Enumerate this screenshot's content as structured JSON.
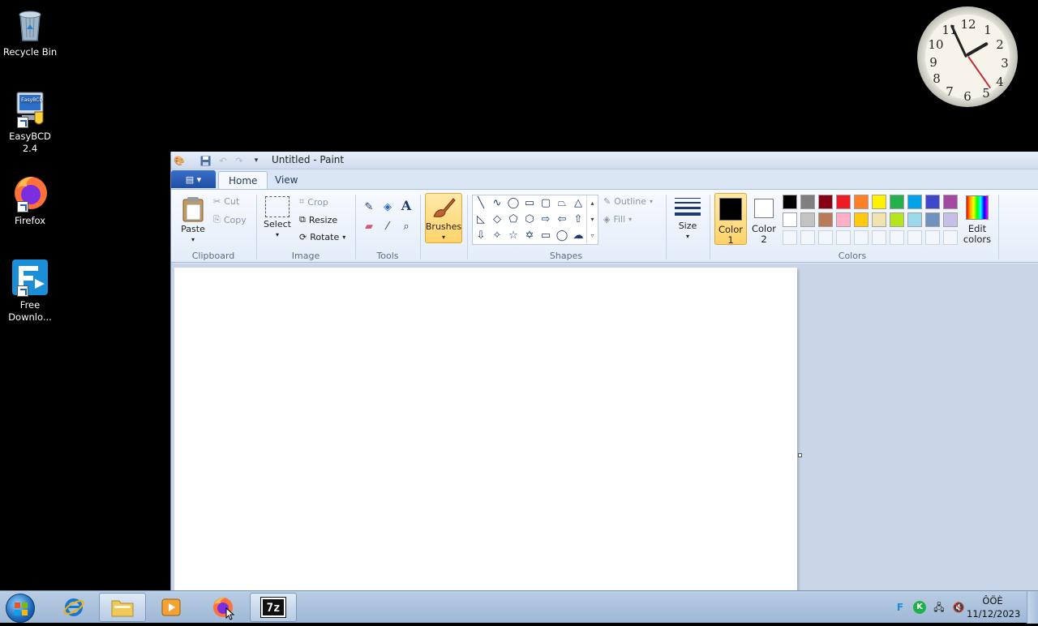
{
  "desktop": {
    "icons": [
      {
        "label": "Recycle Bin"
      },
      {
        "label": "EasyBCD 2.4"
      },
      {
        "label": "Firefox"
      },
      {
        "label": "Free Downlo..."
      }
    ],
    "clock_numbers": [
      "12",
      "1",
      "2",
      "3",
      "4",
      "5",
      "6",
      "7",
      "8",
      "9",
      "10",
      "11"
    ]
  },
  "paint": {
    "title": "Untitled - Paint",
    "tabs": {
      "home": "Home",
      "view": "View"
    },
    "clipboard": {
      "paste": "Paste",
      "cut": "Cut",
      "copy": "Copy",
      "label": "Clipboard"
    },
    "image": {
      "select": "Select",
      "crop": "Crop",
      "resize": "Resize",
      "rotate": "Rotate",
      "label": "Image"
    },
    "tools": {
      "label": "Tools"
    },
    "brushes": {
      "label": "Brushes"
    },
    "shapes": {
      "outline": "Outline",
      "fill": "Fill",
      "label": "Shapes"
    },
    "size": {
      "label": "Size"
    },
    "colors": {
      "color1_line1": "Color",
      "color1_line2": "1",
      "color2_line1": "Color",
      "color2_line2": "2",
      "edit_line1": "Edit",
      "edit_line2": "colors",
      "label": "Colors",
      "palette_row1": [
        "#000000",
        "#7f7f7f",
        "#880015",
        "#ed1c24",
        "#ff7f27",
        "#fff200",
        "#22b14c",
        "#00a2e8",
        "#3f48cc",
        "#a349a4"
      ],
      "palette_row2": [
        "#ffffff",
        "#c3c3c3",
        "#b97a57",
        "#ffaec9",
        "#ffc90e",
        "#efe4b0",
        "#b5e61d",
        "#99d9ea",
        "#7092be",
        "#c8bfe7"
      ],
      "color1": "#000000",
      "color2": "#ffffff"
    }
  },
  "taskbar": {
    "time": "ÔÖÈ",
    "date": "11/12/2023"
  }
}
